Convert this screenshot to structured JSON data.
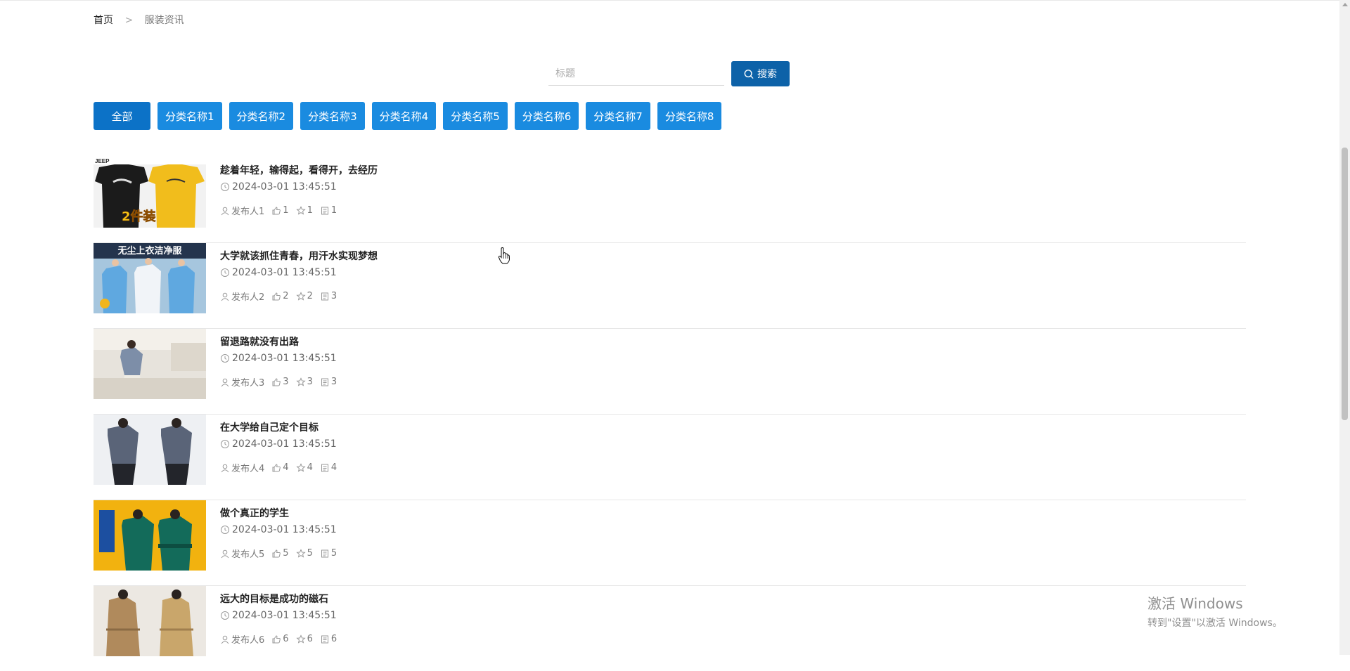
{
  "breadcrumb": {
    "home": "首页",
    "separator": ">",
    "current": "服装资讯"
  },
  "search": {
    "placeholder": "标题",
    "value": "",
    "button_label": "搜索"
  },
  "categories": [
    "全部",
    "分类名称1",
    "分类名称2",
    "分类名称3",
    "分类名称4",
    "分类名称5",
    "分类名称6",
    "分类名称7",
    "分类名称8"
  ],
  "articles": [
    {
      "title": "趁着年轻，输得起，看得开，去经历",
      "time": "2024-03-01 13:45:51",
      "author": "发布人1",
      "likes": "1",
      "favorites": "1",
      "comments": "1",
      "thumb_text": "2件装"
    },
    {
      "title": "大学就该抓住青春，用汗水实现梦想",
      "time": "2024-03-01 13:45:51",
      "author": "发布人2",
      "likes": "2",
      "favorites": "2",
      "comments": "3",
      "thumb_text": "无尘上衣洁净服"
    },
    {
      "title": "留退路就没有出路",
      "time": "2024-03-01 13:45:51",
      "author": "发布人3",
      "likes": "3",
      "favorites": "3",
      "comments": "3"
    },
    {
      "title": "在大学给自己定个目标",
      "time": "2024-03-01 13:45:51",
      "author": "发布人4",
      "likes": "4",
      "favorites": "4",
      "comments": "4"
    },
    {
      "title": "做个真正的学生",
      "time": "2024-03-01 13:45:51",
      "author": "发布人5",
      "likes": "5",
      "favorites": "5",
      "comments": "5"
    },
    {
      "title": "远大的目标是成功的磁石",
      "time": "2024-03-01 13:45:51",
      "author": "发布人6",
      "likes": "6",
      "favorites": "6",
      "comments": "6"
    }
  ],
  "icons": {
    "search": "search-icon",
    "clock": "clock-icon",
    "user": "user-icon",
    "like": "thumbs-up-icon",
    "favorite": "star-icon",
    "comment": "comment-icon"
  },
  "colors": {
    "primary": "#1a8be0",
    "primary_active": "#0c72c7",
    "search_button": "#0d62a8"
  },
  "watermark": {
    "line1": "激活 Windows",
    "line2": "转到\"设置\"以激活 Windows。"
  }
}
